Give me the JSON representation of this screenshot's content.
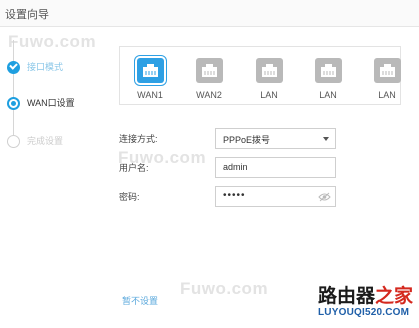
{
  "window": {
    "title": "设置向导"
  },
  "watermarks": [
    "Fuwo.com",
    "Fuwo.com",
    "Fuwo.com"
  ],
  "steps": [
    {
      "label": "接口模式",
      "state": "done"
    },
    {
      "label": "WAN口设置",
      "state": "current"
    },
    {
      "label": "完成设置",
      "state": "todo"
    }
  ],
  "ports": [
    {
      "label": "WAN1",
      "active": true
    },
    {
      "label": "WAN2",
      "active": false
    },
    {
      "label": "LAN",
      "active": false
    },
    {
      "label": "LAN",
      "active": false
    },
    {
      "label": "LAN",
      "active": false
    }
  ],
  "form": {
    "conn_label": "连接方式:",
    "conn_value": "PPPoE拨号",
    "user_label": "用户名:",
    "user_value": "admin",
    "pwd_label": "密码:",
    "pwd_value": "•••••"
  },
  "footer": {
    "skip": "暂不设置"
  },
  "brand": {
    "name_black": "路由器",
    "name_red": "之家",
    "url": "LUYOUQI520.COM"
  },
  "colors": {
    "accent": "#1e9fe0",
    "port_inactive": "#b9b9b9",
    "brand_red": "#d4281e",
    "brand_blue": "#1f5fa8"
  },
  "icons": [
    "ethernet-port-icon",
    "check-icon",
    "dropdown-arrow-icon",
    "eye-slash-icon"
  ]
}
